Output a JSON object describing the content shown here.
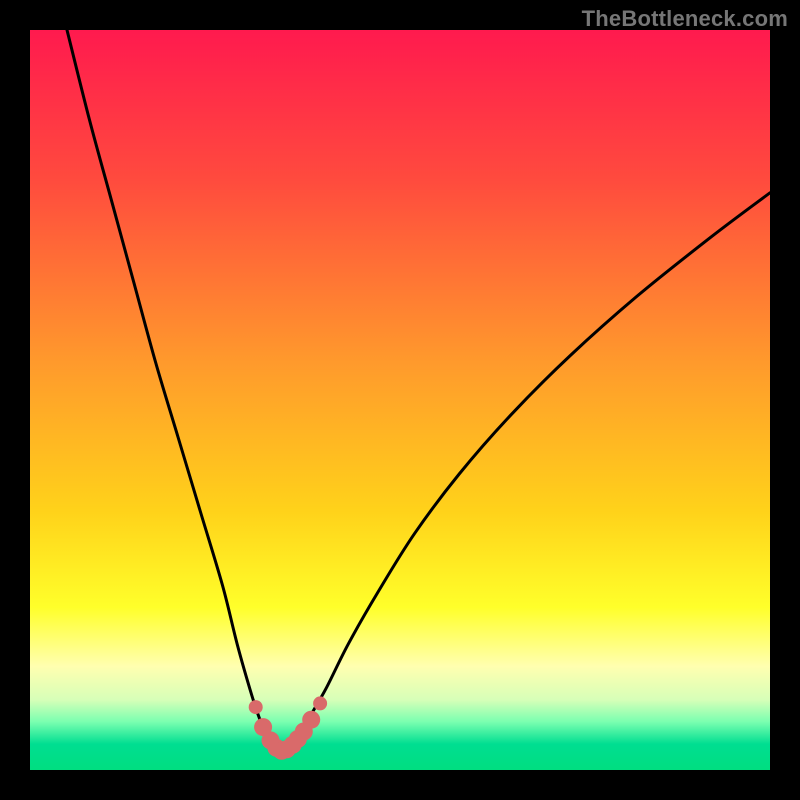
{
  "watermark": "TheBottleneck.com",
  "colors": {
    "frame": "#000000",
    "curve": "#000000",
    "marker": "#d96a6a",
    "gradient_stops": [
      {
        "offset": 0.0,
        "color": "#ff1a4e"
      },
      {
        "offset": 0.2,
        "color": "#ff4a3e"
      },
      {
        "offset": 0.45,
        "color": "#ff9a2c"
      },
      {
        "offset": 0.65,
        "color": "#ffd21a"
      },
      {
        "offset": 0.78,
        "color": "#ffff2a"
      },
      {
        "offset": 0.86,
        "color": "#ffffb0"
      },
      {
        "offset": 0.905,
        "color": "#d7ffb8"
      },
      {
        "offset": 0.935,
        "color": "#7affb0"
      },
      {
        "offset": 0.965,
        "color": "#00de91"
      },
      {
        "offset": 1.0,
        "color": "#00de80"
      }
    ]
  },
  "chart_data": {
    "type": "line",
    "title": "",
    "xlabel": "",
    "ylabel": "",
    "xlim": [
      0,
      100
    ],
    "ylim": [
      0,
      100
    ],
    "grid": false,
    "legend": false,
    "x_at_min": 34,
    "series": [
      {
        "name": "bottleneck-curve",
        "x": [
          5,
          8,
          11,
          14,
          17,
          20,
          23,
          26,
          28,
          30,
          31,
          32,
          33,
          34,
          35,
          36,
          37,
          38,
          40,
          43,
          47,
          52,
          58,
          65,
          73,
          82,
          92,
          100
        ],
        "y": [
          100,
          88,
          77,
          66,
          55,
          45,
          35,
          25,
          17,
          10,
          7,
          4.5,
          3,
          2.5,
          3,
          4,
          5.5,
          7.5,
          11,
          17,
          24,
          32,
          40,
          48,
          56,
          64,
          72,
          78
        ]
      }
    ],
    "markers": {
      "name": "highlight-dots",
      "x": [
        30.5,
        31.5,
        32.5,
        33.3,
        34.0,
        34.7,
        35.5,
        36.2,
        37.0,
        38.0,
        39.2
      ],
      "y": [
        8.5,
        5.8,
        4.0,
        3.0,
        2.6,
        2.8,
        3.4,
        4.2,
        5.2,
        6.8,
        9.0
      ]
    }
  }
}
